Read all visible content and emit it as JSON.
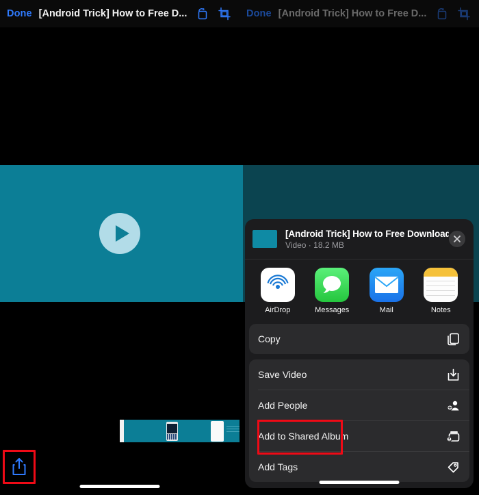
{
  "nav": {
    "done_label": "Done",
    "title": "[Android Trick] How to Free D...",
    "rotate_icon": "rotate-icon",
    "crop_icon": "crop-icon"
  },
  "player": {
    "play_icon": "play-icon",
    "share_icon": "share-icon",
    "timeline_icon": "video-timeline"
  },
  "share_sheet": {
    "item_title": "[Android Trick] How to Free Download...",
    "item_subtitle": "Video · 18.2 MB",
    "close_icon": "close-icon",
    "apps": [
      {
        "label": "AirDrop",
        "icon": "airdrop-icon"
      },
      {
        "label": "Messages",
        "icon": "messages-icon"
      },
      {
        "label": "Mail",
        "icon": "mail-icon"
      },
      {
        "label": "Notes",
        "icon": "notes-icon"
      }
    ],
    "actions": [
      {
        "label": "Copy",
        "icon": "copy-icon"
      },
      {
        "label": "Save Video",
        "icon": "save-download-icon"
      },
      {
        "label": "Add People",
        "icon": "add-person-icon"
      },
      {
        "label": "Add to Shared Album",
        "icon": "shared-album-icon"
      },
      {
        "label": "Add Tags",
        "icon": "tag-icon"
      }
    ]
  },
  "annotations": {
    "highlight_color": "#ef0a16",
    "share_button_highlight": "share-button",
    "save_video_highlight": "save-video-row"
  },
  "colors": {
    "accent_blue": "#2f7bff",
    "video_teal": "#0c7e96",
    "video_teal_dimmed": "#0b4450",
    "sheet_background": "#1c1c1e",
    "row_background": "#2b2b2d"
  }
}
